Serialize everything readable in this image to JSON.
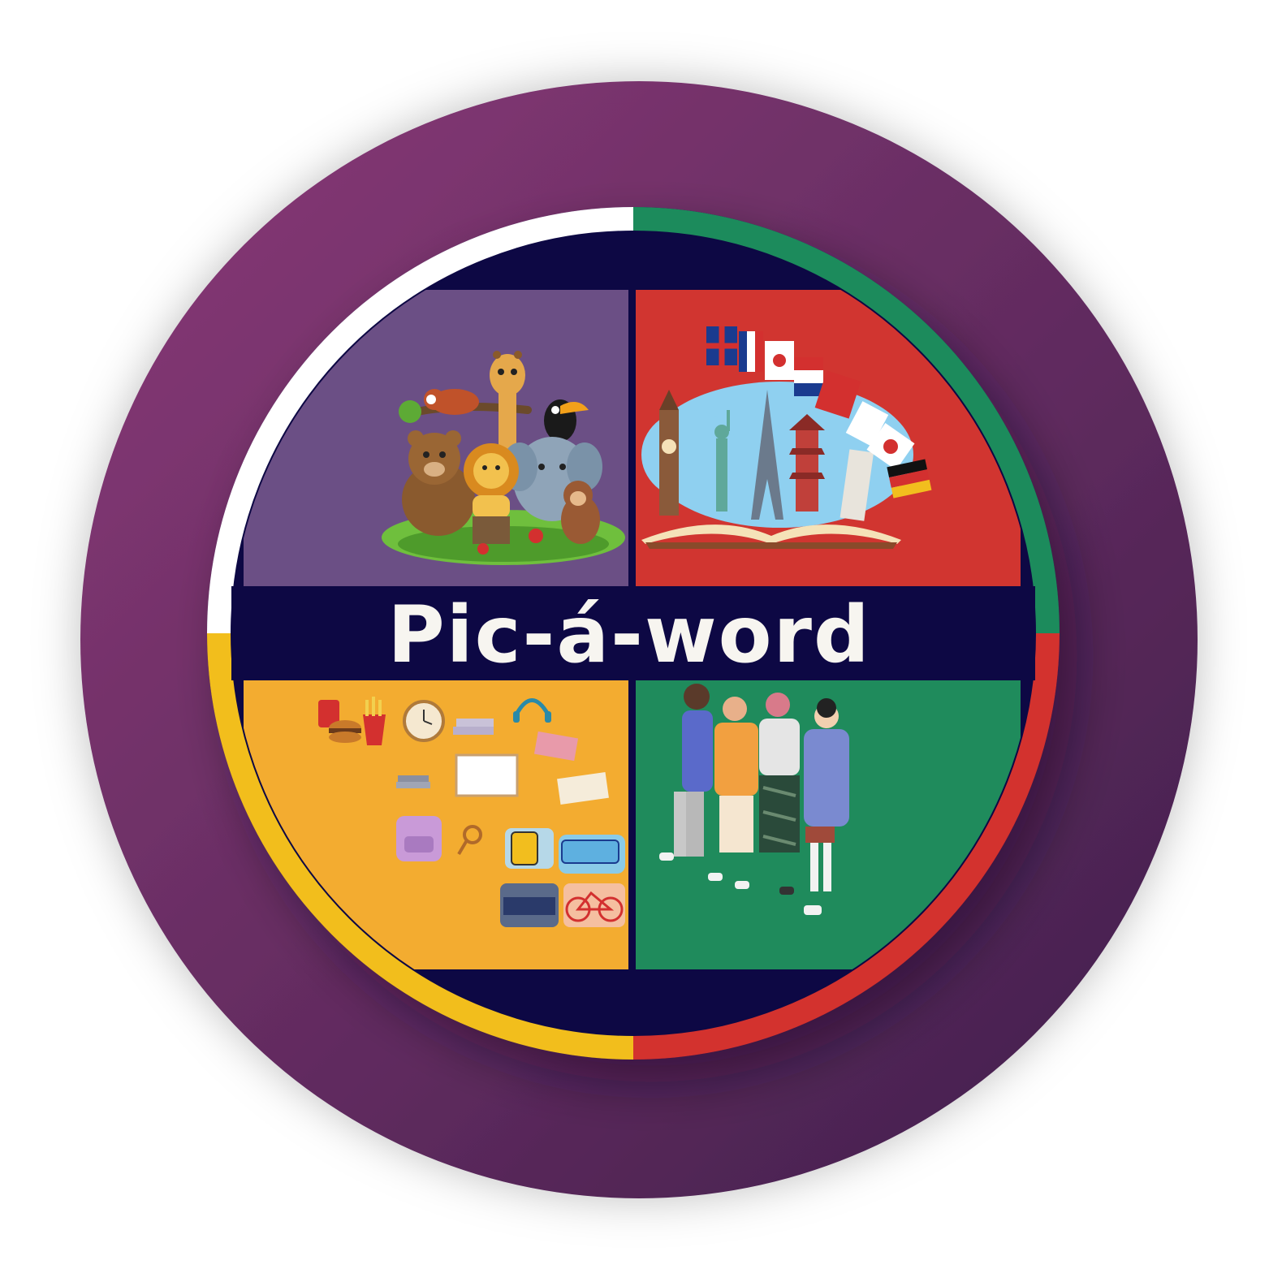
{
  "logo": {
    "title": "Pic-á-word",
    "colors": {
      "outer_disc_start": "#8B3A78",
      "outer_disc_end": "#3F1F4B",
      "ring_white": "#ffffff",
      "ring_green": "#1F8B5C",
      "ring_red": "#D3302F",
      "ring_yellow": "#F2BE1E",
      "inner_disc": "#0D0844",
      "quadrant_animals": "#6B4F85",
      "quadrant_languages": "#D13530",
      "quadrant_objects": "#F3AC30",
      "quadrant_people": "#1F8B5C",
      "title_text": "#F7F5F0"
    },
    "quadrants": [
      {
        "theme": "animals",
        "icon": "zoo-animals-illustration"
      },
      {
        "theme": "languages",
        "icon": "world-landmarks-flags-illustration"
      },
      {
        "theme": "everyday-objects",
        "icon": "food-school-transport-illustration"
      },
      {
        "theme": "people",
        "icon": "group-of-friends-illustration"
      }
    ]
  }
}
